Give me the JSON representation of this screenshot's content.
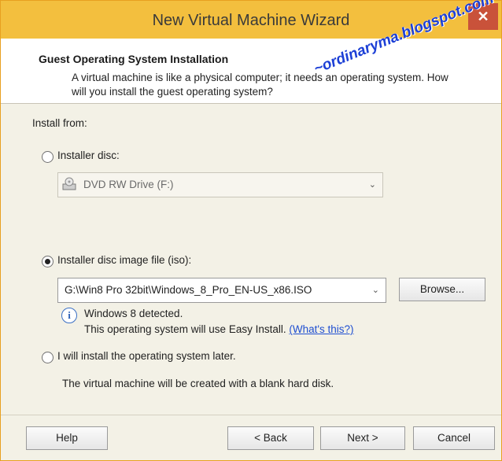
{
  "window": {
    "title": "New Virtual Machine Wizard",
    "close_symbol": "✕"
  },
  "header": {
    "title": "Guest Operating System Installation",
    "description": "A virtual machine is like a physical computer; it needs an operating system. How will you install the guest operating system?"
  },
  "watermark": "~ordinaryma.blogspot.com~",
  "install_from": {
    "label": "Install from:",
    "installer_disc": {
      "label": "Installer disc:",
      "selected": false,
      "drive": "DVD RW Drive (F:)"
    },
    "iso": {
      "label": "Installer disc image file (iso):",
      "selected": true,
      "path": "G:\\Win8 Pro 32bit\\Windows_8_Pro_EN-US_x86.ISO",
      "browse_label": "Browse...",
      "detected": "Windows 8 detected.",
      "easy_install": "This operating system will use Easy Install.",
      "whats_this": "(What's this?)"
    },
    "later": {
      "label": "I will install the operating system later.",
      "selected": false,
      "note": "The virtual machine will be created with a blank hard disk."
    }
  },
  "buttons": {
    "help": "Help",
    "back": "< Back",
    "next": "Next >",
    "cancel": "Cancel"
  },
  "icons": {
    "info": "i",
    "drive": "cd-drive-icon",
    "dropdown": "⌄"
  }
}
